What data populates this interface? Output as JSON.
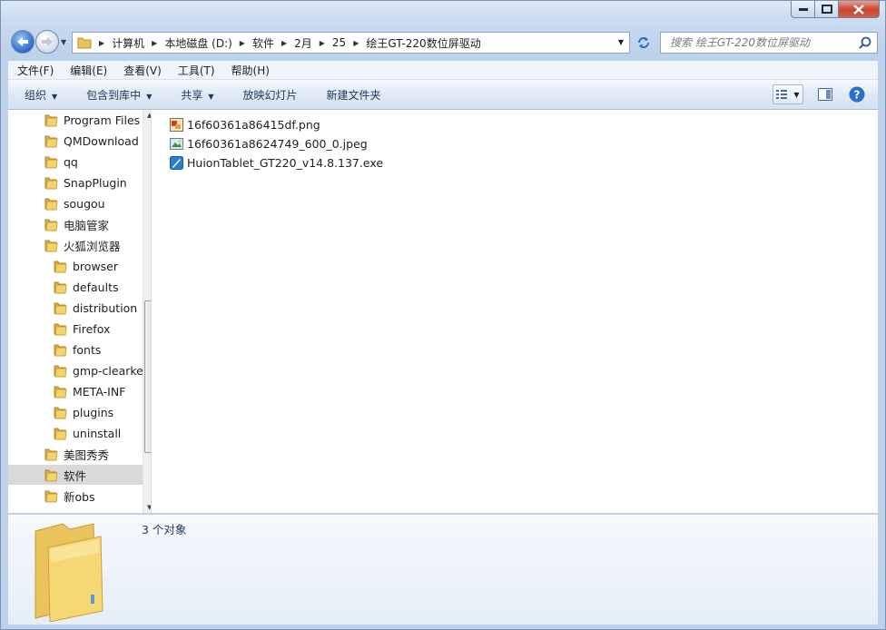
{
  "window": {
    "caption_buttons": [
      "minimize",
      "maximize",
      "close"
    ]
  },
  "nav": {
    "breadcrumb": [
      "计算机",
      "本地磁盘 (D:)",
      "软件",
      "2月",
      "25",
      "绘王GT-220数位屏驱动"
    ],
    "search_placeholder": "搜索 绘王GT-220数位屏驱动"
  },
  "menu": {
    "items": [
      "文件(F)",
      "编辑(E)",
      "查看(V)",
      "工具(T)",
      "帮助(H)"
    ]
  },
  "commands": {
    "organize": "组织",
    "include_library": "包含到库中",
    "share": "共享",
    "slideshow": "放映幻灯片",
    "new_folder": "新建文件夹"
  },
  "tree": {
    "items": [
      {
        "label": "Program Files",
        "level": 1
      },
      {
        "label": "QMDownload",
        "level": 1
      },
      {
        "label": "qq",
        "level": 1
      },
      {
        "label": "SnapPlugin",
        "level": 1
      },
      {
        "label": "sougou",
        "level": 1
      },
      {
        "label": "电脑管家",
        "level": 1
      },
      {
        "label": "火狐浏览器",
        "level": 1
      },
      {
        "label": "browser",
        "level": 2
      },
      {
        "label": "defaults",
        "level": 2
      },
      {
        "label": "distribution",
        "level": 2
      },
      {
        "label": "Firefox",
        "level": 2
      },
      {
        "label": "fonts",
        "level": 2
      },
      {
        "label": "gmp-clearkey",
        "level": 2
      },
      {
        "label": "META-INF",
        "level": 2
      },
      {
        "label": "plugins",
        "level": 2
      },
      {
        "label": "uninstall",
        "level": 2
      },
      {
        "label": "美图秀秀",
        "level": 1
      },
      {
        "label": "软件",
        "level": 1,
        "selected": true
      },
      {
        "label": "新obs",
        "level": 1
      }
    ]
  },
  "files": [
    {
      "name": "16f60361a86415df.png",
      "icon": "png-image-icon"
    },
    {
      "name": "16f60361a8624749_600_0.jpeg",
      "icon": "jpeg-image-icon"
    },
    {
      "name": "HuionTablet_GT220_v14.8.137.exe",
      "icon": "exe-app-icon"
    }
  ],
  "details": {
    "count": "3 个对象"
  },
  "colors": {
    "folder": "#f3d36b",
    "accent_blue": "#2c6bc6",
    "close_red": "#c8432c"
  }
}
